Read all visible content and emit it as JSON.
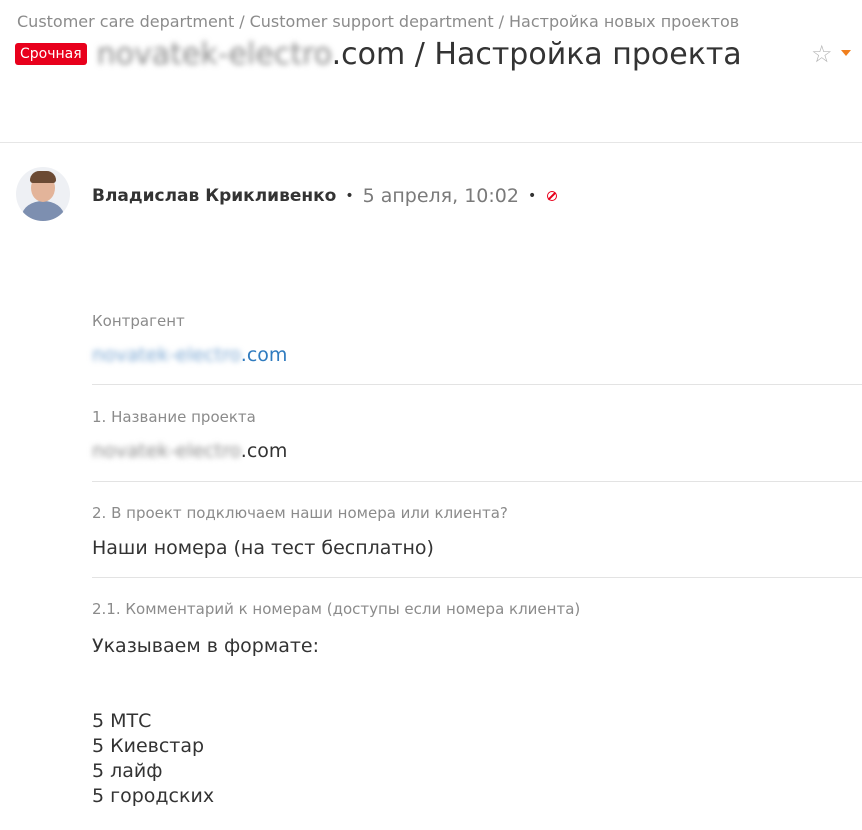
{
  "breadcrumb": [
    "Customer care department",
    "Customer support department",
    "Настройка новых проектов"
  ],
  "breadcrumb_separator": "/",
  "badge": "Срочная",
  "title": {
    "domain_blurred": "novatek-electro",
    "domain_suffix": ".com",
    "rest": " / Настройка проекта"
  },
  "author": {
    "name": "Владислав Крикливенко",
    "timestamp": "5 апреля, 10:02"
  },
  "fields": [
    {
      "label": "Контрагент",
      "value_blurred": "novatek-electro",
      "value_suffix": ".com",
      "is_link": true
    },
    {
      "label": "1. Название проекта",
      "value_blurred": "novatek-electro",
      "value_suffix": ".com",
      "is_link": false
    },
    {
      "label": "2. В проект подключаем наши номера или клиента?",
      "value": "Наши номера (на тест бесплатно)"
    },
    {
      "label": "2.1. Комментарий к номерам (доступы если номера клиента)",
      "lines": [
        "Указываем в формате:",
        "",
        "",
        "5 МТС",
        "5 Киевстар",
        "5 лайф",
        "5 городских"
      ]
    }
  ],
  "colors": {
    "badge": "#e8001c",
    "link": "#2f7bbf",
    "star_caret": "#f07f1d"
  },
  "icons": [
    "star-outline-icon",
    "chevron-down-icon",
    "block-icon"
  ]
}
